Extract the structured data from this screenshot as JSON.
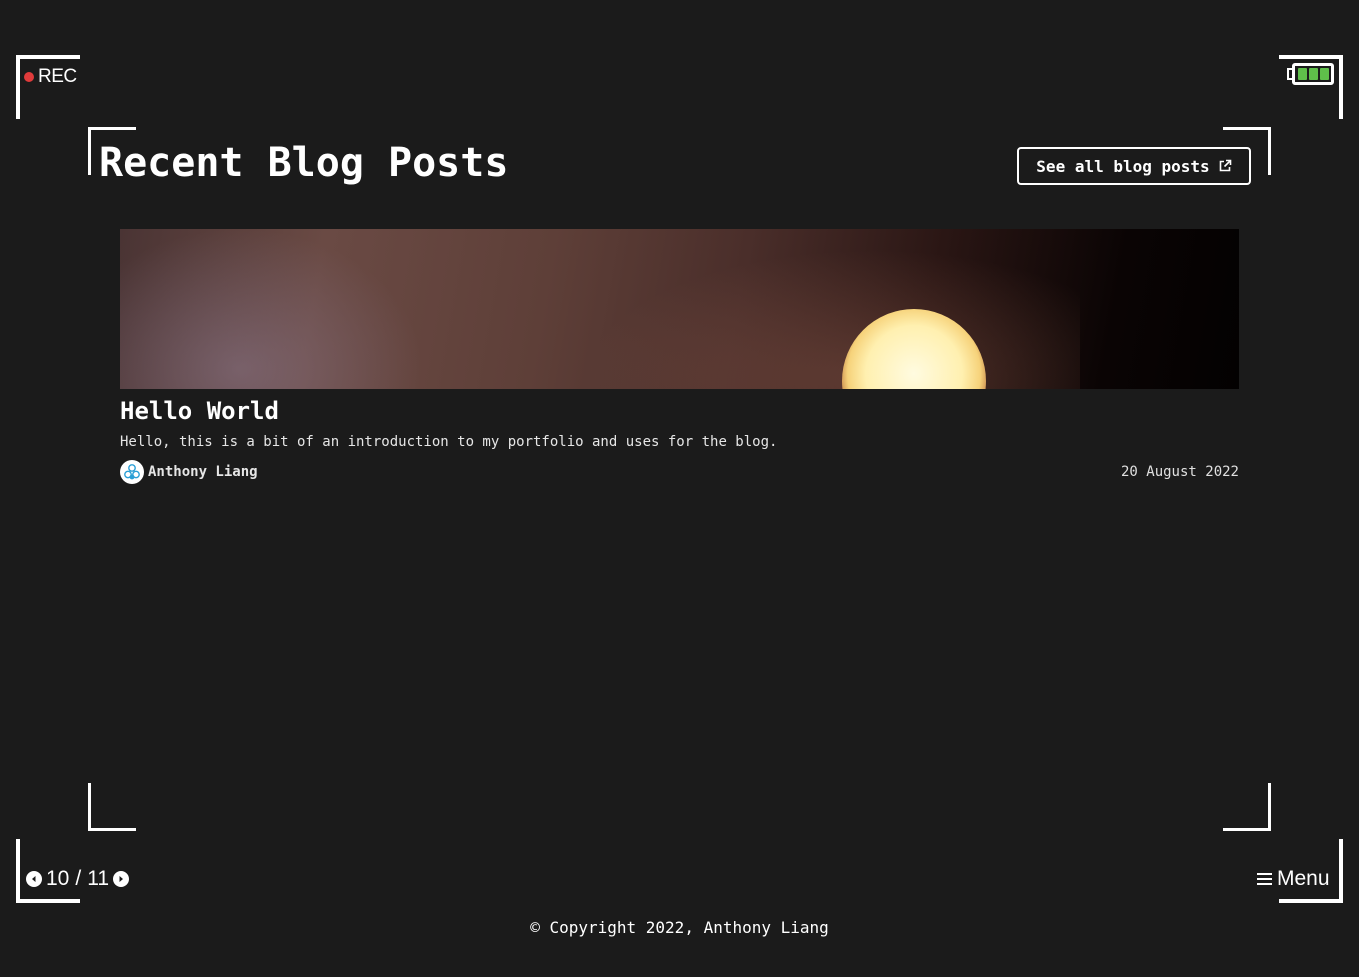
{
  "viewfinder": {
    "rec_label": "REC",
    "battery_bars": 3,
    "battery_color": "#5fbf4a",
    "rec_color": "#e03b3b"
  },
  "section": {
    "title": "Recent Blog Posts",
    "see_all_label": "See all blog posts",
    "see_all_icon": "external-link-icon"
  },
  "posts": [
    {
      "title": "Hello World",
      "description": "Hello, this is a bit of an introduction to my portfolio and uses for the blog.",
      "author": "Anthony Liang",
      "date": "20 August 2022",
      "avatar_icon": "avatar-logo-icon"
    }
  ],
  "pager": {
    "current": "10",
    "separator": "/",
    "total": "11",
    "prev_icon": "chevron-left-circle-icon",
    "next_icon": "chevron-right-circle-icon"
  },
  "menu": {
    "label": "Menu",
    "icon": "hamburger-icon"
  },
  "footer": {
    "copyright": "© Copyright 2022, Anthony Liang"
  },
  "colors": {
    "background": "#1b1b1b",
    "text": "#ffffff"
  }
}
